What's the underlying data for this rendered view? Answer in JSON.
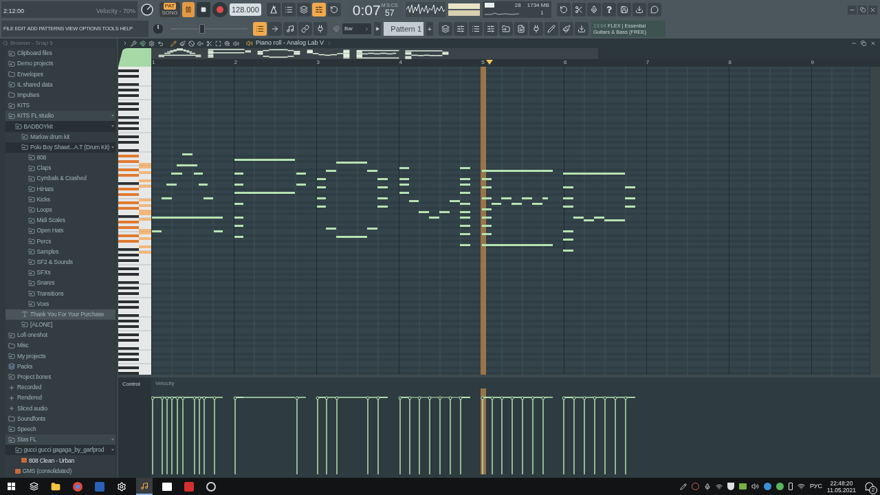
{
  "hint_panel": {
    "time": "2:12:00",
    "hint": "Velocity - 70%"
  },
  "transport": {
    "modes": [
      {
        "label": "PAT",
        "selected": true
      },
      {
        "label": "SONG",
        "selected": false
      }
    ],
    "tempo": "128.000"
  },
  "tools_row_1": [
    {
      "on": false
    },
    {
      "on": false
    },
    {
      "on": false
    },
    {
      "on": true
    },
    {
      "on": false
    }
  ],
  "time_display": {
    "time": "0:07",
    "centiseconds": "57",
    "unit": "M:S:CS"
  },
  "cpu_panel": {
    "polyphony": "28",
    "memory": "1734 MB",
    "voices": "1"
  },
  "menu": [
    "FILE",
    "EDIT",
    "ADD",
    "PATTERNS",
    "VIEW",
    "OPTIONS",
    "TOOLS",
    "HELP"
  ],
  "master_slider": {
    "level": 0.4
  },
  "tools_row_2": [
    {
      "on": true
    },
    {
      "on": false
    },
    {
      "on": false
    },
    {
      "on": false
    },
    {
      "on": false
    }
  ],
  "snap": "Bar",
  "pattern": "Pattern 1",
  "pattern_add": "+",
  "news": {
    "time": "13:04",
    "headline": "FLEX | Essential Guitars & Bass (FREE)"
  },
  "browser": {
    "title": "Browser - Snap 5",
    "items": [
      {
        "name": "Clipboard files",
        "kind": "link",
        "expanded": false,
        "selected": false
      },
      {
        "name": "Demo projects",
        "kind": "link",
        "expanded": false,
        "selected": false
      },
      {
        "name": "Envelopes",
        "kind": "folder",
        "expanded": false,
        "selected": false
      },
      {
        "name": "IL shared data",
        "kind": "link",
        "expanded": false,
        "selected": false
      },
      {
        "name": "Impulses",
        "kind": "folder",
        "expanded": false,
        "selected": false
      },
      {
        "name": "KITS",
        "kind": "link",
        "expanded": false,
        "selected": false
      },
      {
        "name": "KITS FL studio",
        "kind": "link",
        "expanded": true,
        "selected": false,
        "children": [
          {
            "name": "BADBOYkit",
            "kind": "link",
            "expanded": true,
            "selected": false,
            "children": [
              {
                "name": "Marlow drum kit",
                "kind": "link",
                "expanded": false,
                "selected": false
              },
              {
                "name": "Polo Boy Shawt...A.T (Drum Kit)",
                "kind": "link",
                "expanded": true,
                "selected": false,
                "children": [
                  {
                    "name": "808",
                    "kind": "link",
                    "expanded": false,
                    "selected": false
                  },
                  {
                    "name": "Claps",
                    "kind": "link",
                    "expanded": false,
                    "selected": false
                  },
                  {
                    "name": "Cymbals & Crashed",
                    "kind": "link",
                    "expanded": false,
                    "selected": false
                  },
                  {
                    "name": "HiHats",
                    "kind": "link",
                    "expanded": false,
                    "selected": false
                  },
                  {
                    "name": "Kicks",
                    "kind": "link",
                    "expanded": false,
                    "selected": false
                  },
                  {
                    "name": "Loops",
                    "kind": "link",
                    "expanded": false,
                    "selected": false
                  },
                  {
                    "name": "Midi Scales",
                    "kind": "link",
                    "expanded": false,
                    "selected": false
                  },
                  {
                    "name": "Open Hats",
                    "kind": "link",
                    "expanded": false,
                    "selected": false
                  },
                  {
                    "name": "Percs",
                    "kind": "link",
                    "expanded": false,
                    "selected": false
                  },
                  {
                    "name": "Samples",
                    "kind": "link",
                    "expanded": false,
                    "selected": false
                  },
                  {
                    "name": "SF2 & Sounds",
                    "kind": "link",
                    "expanded": false,
                    "selected": false
                  },
                  {
                    "name": "SFXs",
                    "kind": "link",
                    "expanded": false,
                    "selected": false
                  },
                  {
                    "name": "Snares",
                    "kind": "link",
                    "expanded": false,
                    "selected": false
                  },
                  {
                    "name": "Transitions",
                    "kind": "link",
                    "expanded": false,
                    "selected": false
                  },
                  {
                    "name": "Voxs",
                    "kind": "link",
                    "expanded": false,
                    "selected": false
                  }
                ]
              },
              {
                "name": "Thank You For Your Purchase",
                "kind": "text",
                "expanded": false,
                "selected": true
              },
              {
                "name": "[ALONE]",
                "kind": "link",
                "expanded": false,
                "selected": false
              }
            ]
          }
        ]
      },
      {
        "name": "Lofi oneshot",
        "kind": "link",
        "expanded": false,
        "selected": false
      },
      {
        "name": "Misc",
        "kind": "folder",
        "expanded": false,
        "selected": false
      },
      {
        "name": "My projects",
        "kind": "link",
        "expanded": false,
        "selected": false
      },
      {
        "name": "Packs",
        "kind": "pack",
        "expanded": false,
        "selected": false
      },
      {
        "name": "Project bones",
        "kind": "link",
        "expanded": false,
        "selected": false
      },
      {
        "name": "Recorded",
        "kind": "plus",
        "expanded": false,
        "selected": false
      },
      {
        "name": "Rendered",
        "kind": "plus",
        "expanded": false,
        "selected": false
      },
      {
        "name": "Sliced audio",
        "kind": "plus",
        "expanded": false,
        "selected": false
      },
      {
        "name": "Soundfonts",
        "kind": "folder",
        "expanded": false,
        "selected": false
      },
      {
        "name": "Speech",
        "kind": "link",
        "expanded": false,
        "selected": false
      },
      {
        "name": "Stas FL",
        "kind": "link",
        "expanded": true,
        "selected": false,
        "children": [
          {
            "name": "gucci gucci gagaga_by_garfprod",
            "kind": "link",
            "expanded": true,
            "selected": false,
            "children": [
              {
                "name": "808 Clean - Urban",
                "kind": "audio",
                "expanded": false,
                "selected": false
              }
            ]
          },
          {
            "name": "GMS (consolidated)",
            "kind": "audio",
            "expanded": false,
            "selected": false
          }
        ]
      }
    ]
  },
  "piano_roll": {
    "title": "Piano roll - Analog Lab V",
    "ruler": [
      "1",
      "2",
      "3",
      "4",
      "5",
      "6",
      "7",
      "8",
      "9"
    ],
    "control_label": "Control",
    "control_target": "Velocity"
  },
  "taskbar": {
    "language": "РУС",
    "time": "22:48:20",
    "date": "11.05.2021",
    "notifications": "2"
  }
}
